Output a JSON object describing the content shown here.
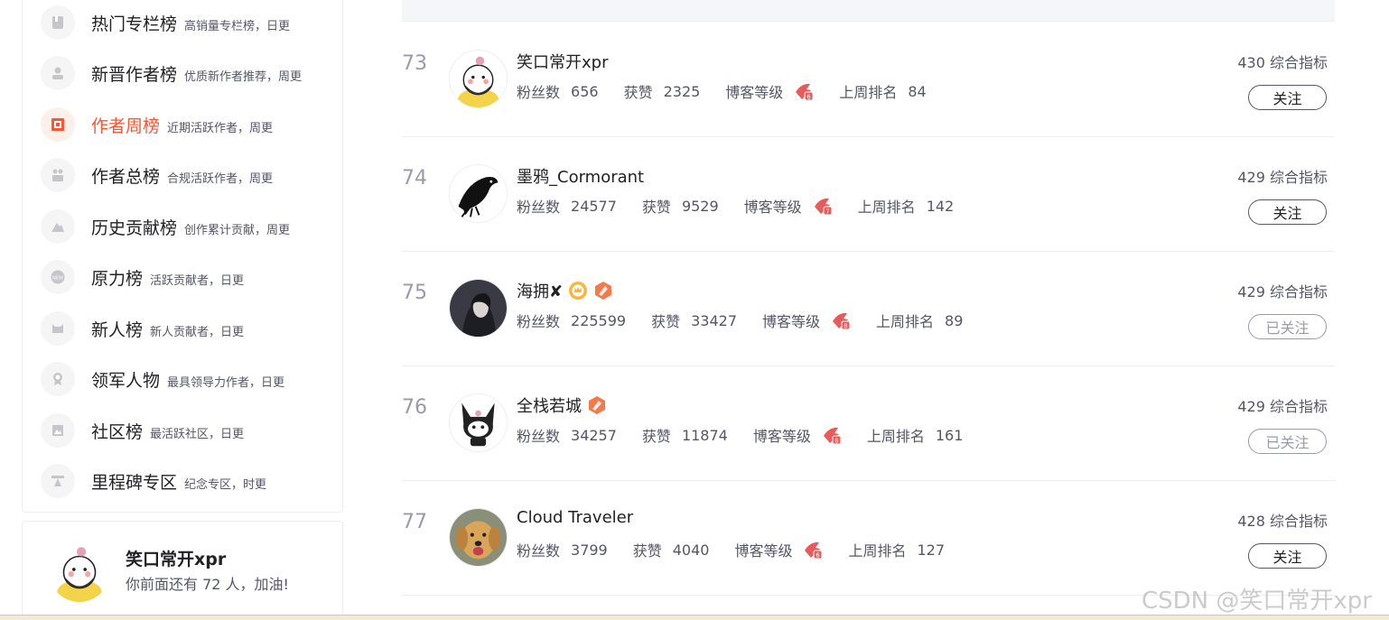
{
  "sidebar": {
    "items": [
      {
        "title": "热门专栏榜",
        "desc": "高销量专栏榜，日更",
        "icon": "column-icon",
        "active": false
      },
      {
        "title": "新晋作者榜",
        "desc": "优质新作者推荐，周更",
        "icon": "new-author-icon",
        "active": false
      },
      {
        "title": "作者周榜",
        "desc": "近期活跃作者，周更",
        "icon": "week-icon",
        "active": true
      },
      {
        "title": "作者总榜",
        "desc": "合规活跃作者，周更",
        "icon": "total-icon",
        "active": false
      },
      {
        "title": "历史贡献榜",
        "desc": "创作累计贡献，周更",
        "icon": "history-icon",
        "active": false
      },
      {
        "title": "原力榜",
        "desc": "活跃贡献者，日更",
        "icon": "new-badge-icon",
        "active": false
      },
      {
        "title": "新人榜",
        "desc": "新人贡献者，日更",
        "icon": "newcomer-icon",
        "active": false
      },
      {
        "title": "领军人物",
        "desc": "最具领导力作者，日更",
        "icon": "medal-icon",
        "active": false
      },
      {
        "title": "社区榜",
        "desc": "最活跃社区，日更",
        "icon": "community-icon",
        "active": false
      },
      {
        "title": "里程碑专区",
        "desc": "纪念专区，时更",
        "icon": "milestone-icon",
        "active": false
      }
    ]
  },
  "me": {
    "name": "笑口常开xpr",
    "message": "你前面还有 72 人，加油!"
  },
  "labels": {
    "fans": "粉丝数",
    "likes": "获赞",
    "level": "博客等级",
    "last_rank": "上周排名",
    "score_suffix": "综合指标"
  },
  "rows": [
    {
      "rank": "73",
      "name": "笑口常开xpr",
      "fans": "656",
      "likes": "2325",
      "level": "6",
      "last_rank": "84",
      "score": "430",
      "follow": "关注",
      "followed": false,
      "badges": []
    },
    {
      "rank": "74",
      "name": "墨鸦_Cormorant",
      "fans": "24577",
      "likes": "9529",
      "level": "7",
      "last_rank": "142",
      "score": "429",
      "follow": "关注",
      "followed": false,
      "badges": []
    },
    {
      "rank": "75",
      "name": "海拥✘",
      "fans": "225599",
      "likes": "33427",
      "level": "8",
      "last_rank": "89",
      "score": "429",
      "follow": "已关注",
      "followed": true,
      "badges": [
        "crown-badge-icon",
        "expert-badge-icon"
      ]
    },
    {
      "rank": "76",
      "name": "全栈若城",
      "fans": "34257",
      "likes": "11874",
      "level": "8",
      "last_rank": "161",
      "score": "429",
      "follow": "已关注",
      "followed": true,
      "badges": [
        "expert-badge-icon"
      ]
    },
    {
      "rank": "77",
      "name": "Cloud Traveler",
      "fans": "3799",
      "likes": "4040",
      "level": "6",
      "last_rank": "127",
      "score": "428",
      "follow": "关注",
      "followed": false,
      "badges": []
    }
  ],
  "watermark": "CSDN @笑口常开xpr",
  "colors": {
    "accent": "#fc5531",
    "text": "#222226",
    "muted": "#555666",
    "rank": "#999aaa"
  }
}
